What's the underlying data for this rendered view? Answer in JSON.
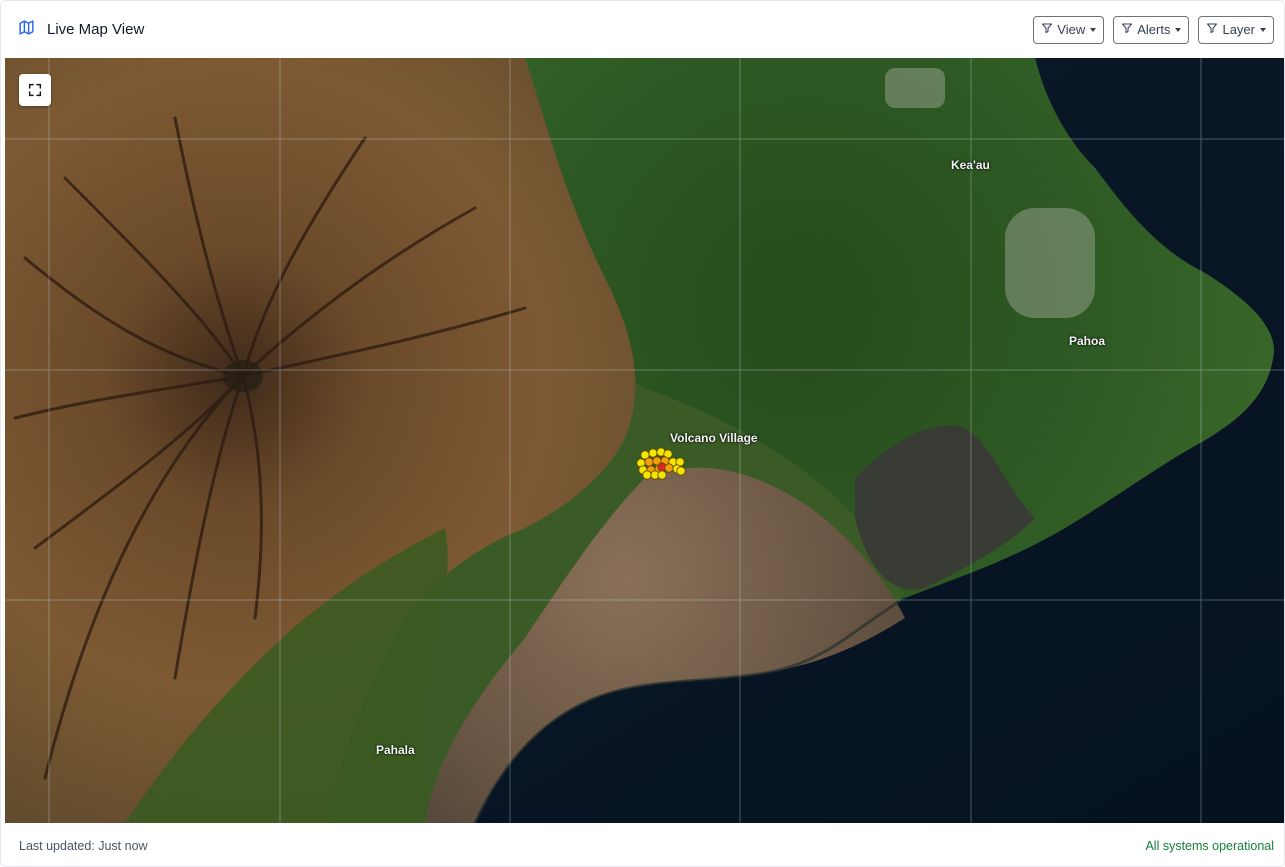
{
  "header": {
    "title": "Live Map View",
    "title_icon": "map-icon",
    "buttons": [
      {
        "label": "View",
        "icon": "filter-icon"
      },
      {
        "label": "Alerts",
        "icon": "filter-icon"
      },
      {
        "label": "Layer",
        "icon": "filter-icon"
      }
    ]
  },
  "map": {
    "fullscreen_icon": "expand-icon",
    "places": {
      "keaau": "Kea'au",
      "pahoa": "Pahoa",
      "volcano_village": "Volcano Village",
      "pahala": "Pahala"
    },
    "marker_colors": {
      "yellow": "#f5e400",
      "orange": "#f59e0b",
      "red": "#dc2626"
    }
  },
  "footer": {
    "last_updated": "Last updated: Just now",
    "status": "All systems operational",
    "status_color": "#15803d"
  }
}
